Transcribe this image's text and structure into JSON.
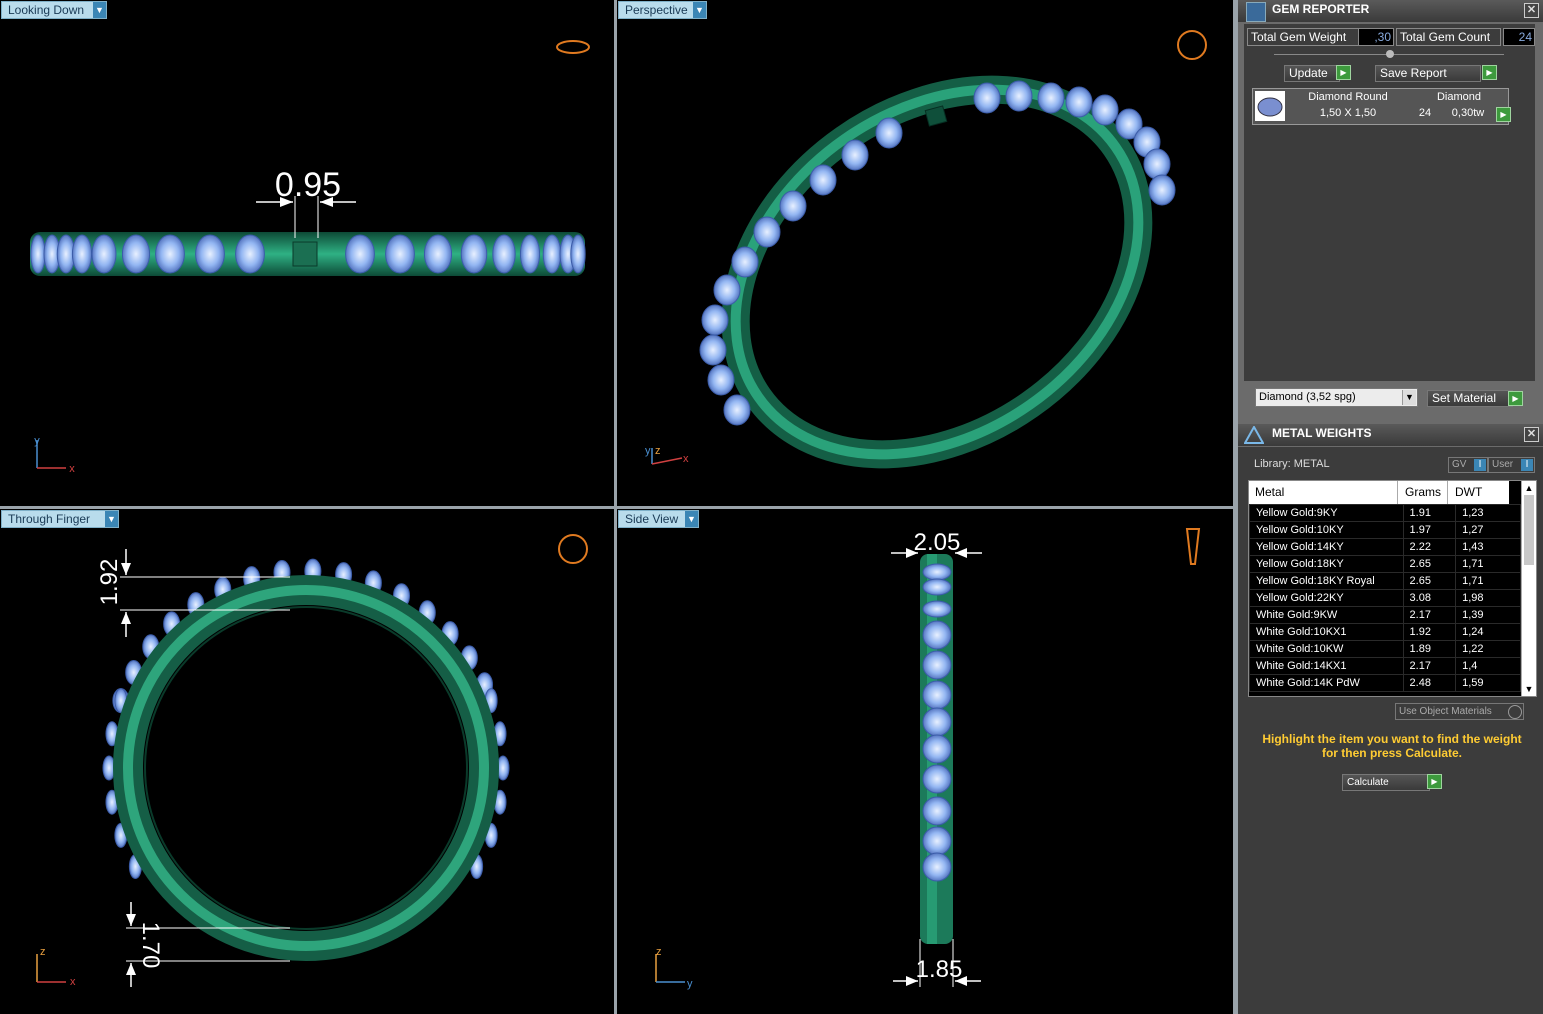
{
  "viewports": {
    "looking_down": {
      "title": "Looking Down",
      "dim": "0.95",
      "axis_y": "y",
      "axis_x": "x"
    },
    "perspective": {
      "title": "Perspective",
      "axis_y": "y",
      "axis_z": "z",
      "axis_x": "x"
    },
    "through_finger": {
      "title": "Through Finger",
      "dim_top": "1.92",
      "dim_bottom": "1.70",
      "axis_z": "z",
      "axis_x": "x"
    },
    "side_view": {
      "title": "Side View",
      "dim_top": "2.05",
      "dim_bottom": "1.85",
      "axis_z": "z",
      "axis_y": "y"
    }
  },
  "gem_reporter": {
    "title": "GEM REPORTER",
    "total_gem_weight_label": "Total Gem Weight",
    "total_gem_weight": ",30",
    "total_gem_count_label": "Total Gem Count",
    "total_gem_count": "24",
    "update_label": "Update",
    "save_report_label": "Save Report",
    "gem_row": {
      "name": "Diamond Round",
      "size": "1,50 X 1,50",
      "material": "Diamond",
      "count": "24",
      "weight": "0,30tw"
    },
    "material_select": "Diamond    (3,52 spg)",
    "set_material_label": "Set Material"
  },
  "metal_weights": {
    "title": "METAL WEIGHTS",
    "library": "Library: METAL",
    "gv_label": "GV",
    "user_label": "User",
    "headers": [
      "Metal",
      "Grams",
      "DWT"
    ],
    "rows": [
      [
        "Yellow Gold:9KY",
        "1.91",
        "1,23"
      ],
      [
        "Yellow Gold:10KY",
        "1.97",
        "1,27"
      ],
      [
        "Yellow Gold:14KY",
        "2.22",
        "1,43"
      ],
      [
        "Yellow Gold:18KY",
        "2.65",
        "1,71"
      ],
      [
        "Yellow Gold:18KY Royal",
        "2.65",
        "1,71"
      ],
      [
        "Yellow Gold:22KY",
        "3.08",
        "1,98"
      ],
      [
        "White Gold:9KW",
        "2.17",
        "1,39"
      ],
      [
        "White Gold:10KX1",
        "1.92",
        "1,24"
      ],
      [
        "White Gold:10KW",
        "1.89",
        "1,22"
      ],
      [
        "White Gold:14KX1",
        "2.17",
        "1,4"
      ],
      [
        "White Gold:14K PdW",
        "2.48",
        "1,59"
      ]
    ],
    "use_object_materials": "Use Object Materials",
    "hint": "Highlight the item you want to find the weight for then press Calculate.",
    "calculate_label": "Calculate"
  },
  "colors": {
    "ring": "#1f8a66",
    "gem": "#8fb4f0",
    "viewport_bg": "#000000",
    "hint": "#ffcc33"
  }
}
